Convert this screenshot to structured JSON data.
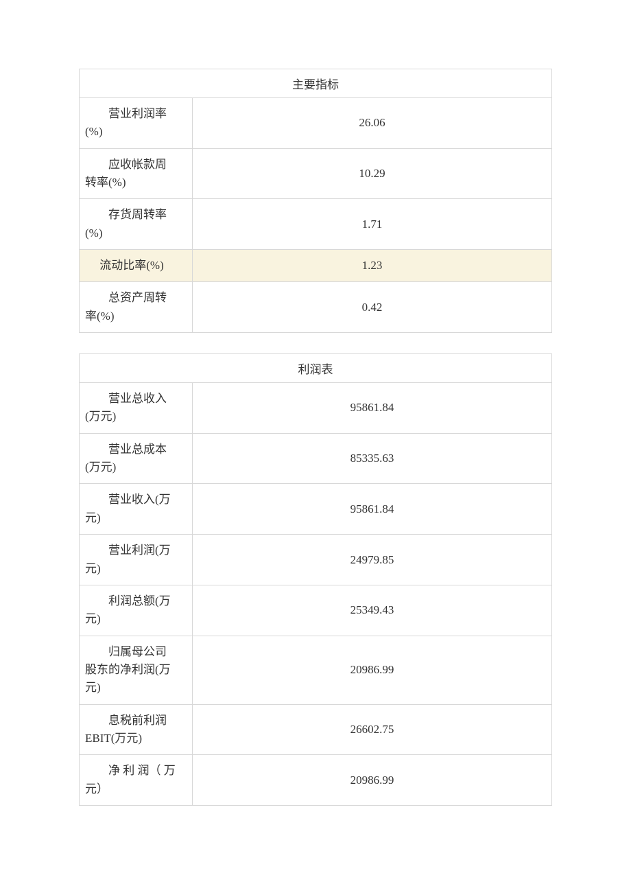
{
  "table1": {
    "title": "主要指标",
    "rows": [
      {
        "label_line1": "　　营业利润率",
        "label_line2": "(%)",
        "value": "26.06",
        "highlighted": false
      },
      {
        "label_line1": "　　应收帐款周",
        "label_line2": "转率(%)",
        "value": "10.29",
        "highlighted": false
      },
      {
        "label_line1": "　　存货周转率",
        "label_line2": "(%)",
        "value": "1.71",
        "highlighted": false
      },
      {
        "label_line1": "　 流动比率(%)",
        "label_line2": "",
        "value": "1.23",
        "highlighted": true
      },
      {
        "label_line1": "　　总资产周转",
        "label_line2": "率(%)",
        "value": "0.42",
        "highlighted": false
      }
    ]
  },
  "table2": {
    "title": "利润表",
    "rows": [
      {
        "label_line1": "　　营业总收入",
        "label_line2": "(万元)",
        "value": "95861.84",
        "highlighted": false
      },
      {
        "label_line1": "　　营业总成本",
        "label_line2": "(万元)",
        "value": "85335.63",
        "highlighted": false
      },
      {
        "label_line1": "　　营业收入(万",
        "label_line2": "元)",
        "value": "95861.84",
        "highlighted": false
      },
      {
        "label_line1": "　　营业利润(万",
        "label_line2": "元)",
        "value": "24979.85",
        "highlighted": false
      },
      {
        "label_line1": "　　利润总额(万",
        "label_line2": "元)",
        "value": "25349.43",
        "highlighted": false
      },
      {
        "label_line1": "　　归属母公司",
        "label_line2": "股东的净利润(万",
        "label_line3": "元)",
        "value": "20986.99",
        "highlighted": false
      },
      {
        "label_line1": "　　息税前利润",
        "label_line2": "EBIT(万元)",
        "value": "26602.75",
        "highlighted": false
      },
      {
        "label_line1": "　　净 利 润（ 万",
        "label_line2": "元）",
        "value": "20986.99",
        "highlighted": false
      }
    ]
  }
}
